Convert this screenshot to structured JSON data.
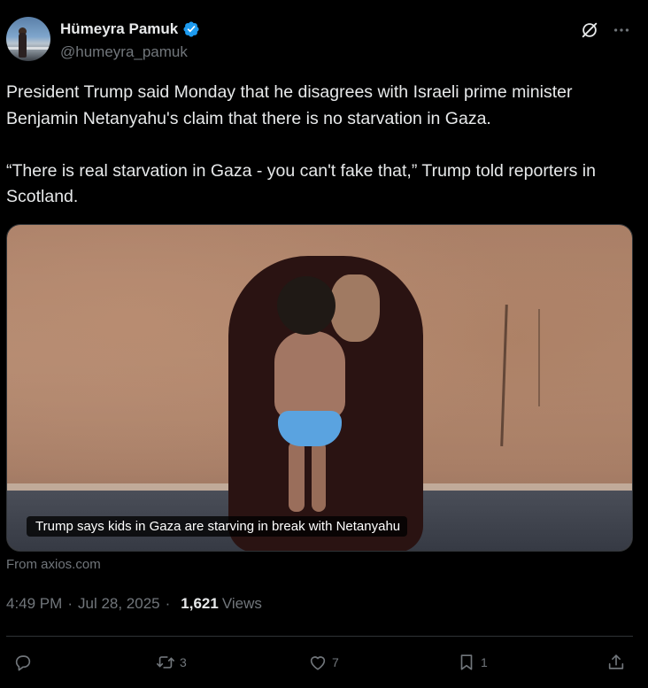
{
  "author": {
    "name": "Hümeyra Pamuk",
    "handle": "@humeyra_pamuk",
    "verified": true
  },
  "tweet": {
    "text": "President Trump said Monday that he disagrees with Israeli prime minister Benjamin Netanyahu's claim that there is no starvation in Gaza.\n\n“There is real starvation in Gaza - you can't fake that,” Trump told reporters in Scotland."
  },
  "media": {
    "caption": "Trump says kids in Gaza are starving in break with Netanyahu",
    "source": "From axios.com"
  },
  "meta": {
    "time": "4:49 PM",
    "date": "Jul 28, 2025",
    "views_count": "1,621",
    "views_label": "Views"
  },
  "actions": {
    "reply_count": "",
    "retweet_count": "3",
    "like_count": "7",
    "bookmark_count": "1"
  },
  "colors": {
    "background": "#000000",
    "text": "#e7e9ea",
    "muted": "#71767b",
    "verified": "#1d9bf0",
    "divider": "#2f3336"
  },
  "icons": [
    "verified-badge-icon",
    "grok-icon",
    "more-icon",
    "reply-icon",
    "retweet-icon",
    "like-icon",
    "bookmark-icon",
    "share-icon"
  ]
}
